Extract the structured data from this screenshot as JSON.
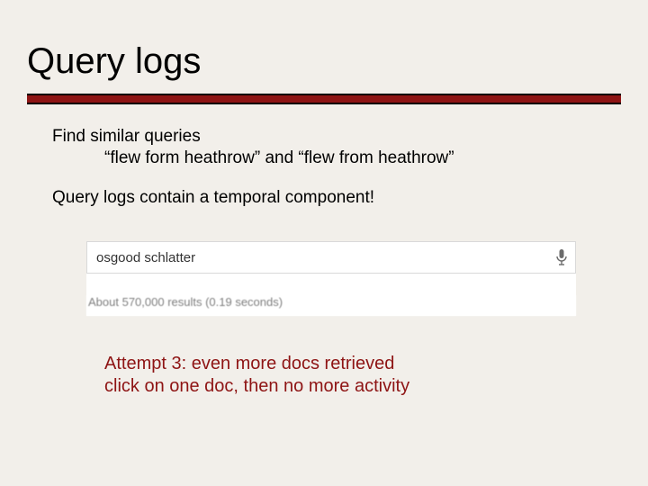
{
  "title": "Query logs",
  "body": {
    "line1": "Find similar queries",
    "line2": "“flew form heathrow” and “flew from heathrow”",
    "line3": "Query logs contain a temporal component!"
  },
  "search": {
    "query": "osgood schlatter",
    "stats": "About 570,000 results (0.19 seconds)"
  },
  "attempt": {
    "l1": "Attempt 3: even more docs retrieved",
    "l2": "click on one doc, then no more activity"
  }
}
